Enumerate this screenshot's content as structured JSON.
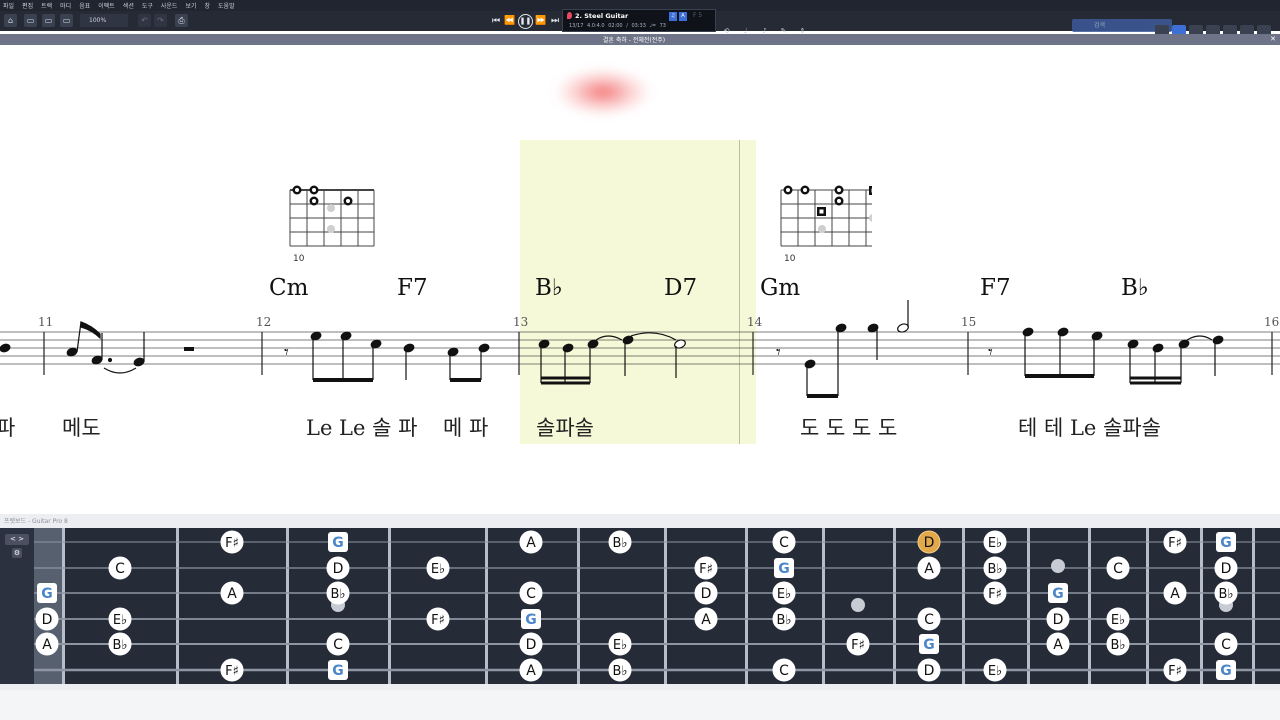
{
  "menu": [
    "파일",
    "편집",
    "트랙",
    "마디",
    "음표",
    "이펙트",
    "섹션",
    "도구",
    "사운드",
    "보기",
    "창",
    "도움말"
  ],
  "toolbar": {
    "zoom": "100%"
  },
  "transport": {
    "track_name": "2. Steel Guitar",
    "bar_position": "13/17",
    "time_signature": "4.0:4.0",
    "time": "02:00 / 03:33",
    "tempo": "♩= 73",
    "mini_label": "F 5"
  },
  "search": {
    "placeholder": "검색"
  },
  "header": {
    "title": "결혼 축하 - 전체전(전주)"
  },
  "score": {
    "chords": [
      {
        "name": "Cm"
      },
      {
        "name": "F7"
      },
      {
        "name": "B♭"
      },
      {
        "name": "D7"
      },
      {
        "name": "Gm"
      },
      {
        "name": "F7"
      },
      {
        "name": "B♭"
      }
    ],
    "diagrams": [
      {
        "fret": "10"
      },
      {
        "fret": "10"
      }
    ],
    "bars": [
      "11",
      "12",
      "13",
      "14",
      "15",
      "16"
    ],
    "lyrics": [
      "파",
      "메도",
      "Le Le 솔 파",
      "메 파",
      "솔파솔",
      "도 도 도 도",
      "테 테 Le 솔파솔"
    ]
  },
  "fretboard": {
    "title": "프렛보드 - Guitar Pro 8",
    "nav": "< >",
    "gear": "⚙",
    "notes": [
      {
        "label": "G",
        "kind": "root"
      },
      {
        "label": "D",
        "kind": "note"
      },
      {
        "label": "A",
        "kind": "note"
      },
      {
        "label": "C",
        "kind": "note"
      },
      {
        "label": "E♭",
        "kind": "note"
      },
      {
        "label": "B♭",
        "kind": "note"
      },
      {
        "label": "F♯",
        "kind": "note"
      },
      {
        "label": "A",
        "kind": "note"
      },
      {
        "label": "F♯",
        "kind": "note"
      },
      {
        "label": "G",
        "kind": "root"
      },
      {
        "label": "D",
        "kind": "note"
      },
      {
        "label": "B♭",
        "kind": "note"
      },
      {
        "label": "C",
        "kind": "note"
      },
      {
        "label": "G",
        "kind": "root"
      },
      {
        "label": "E♭",
        "kind": "note"
      },
      {
        "label": "F♯",
        "kind": "note"
      },
      {
        "label": "A",
        "kind": "note"
      },
      {
        "label": "C",
        "kind": "note"
      },
      {
        "label": "G",
        "kind": "root"
      },
      {
        "label": "D",
        "kind": "note"
      },
      {
        "label": "A",
        "kind": "note"
      },
      {
        "label": "B♭",
        "kind": "note"
      },
      {
        "label": "E♭",
        "kind": "note"
      },
      {
        "label": "B♭",
        "kind": "note"
      },
      {
        "label": "F♯",
        "kind": "note"
      },
      {
        "label": "D",
        "kind": "note"
      },
      {
        "label": "A",
        "kind": "note"
      },
      {
        "label": "C",
        "kind": "note"
      },
      {
        "label": "G",
        "kind": "root"
      },
      {
        "label": "E♭",
        "kind": "note"
      },
      {
        "label": "B♭",
        "kind": "note"
      },
      {
        "label": "C",
        "kind": "note"
      },
      {
        "label": "F♯",
        "kind": "note"
      },
      {
        "label": "D",
        "kind": "active"
      },
      {
        "label": "A",
        "kind": "note"
      },
      {
        "label": "C",
        "kind": "note"
      },
      {
        "label": "G",
        "kind": "root"
      },
      {
        "label": "D",
        "kind": "note"
      },
      {
        "label": "E♭",
        "kind": "note"
      },
      {
        "label": "B♭",
        "kind": "note"
      },
      {
        "label": "F♯",
        "kind": "note"
      },
      {
        "label": "E♭",
        "kind": "note"
      },
      {
        "label": "G",
        "kind": "root"
      },
      {
        "label": "D",
        "kind": "note"
      },
      {
        "label": "A",
        "kind": "note"
      },
      {
        "label": "C",
        "kind": "note"
      },
      {
        "label": "E♭",
        "kind": "note"
      },
      {
        "label": "B♭",
        "kind": "note"
      },
      {
        "label": "A",
        "kind": "note"
      },
      {
        "label": "F♯",
        "kind": "note"
      },
      {
        "label": "F♯",
        "kind": "note"
      },
      {
        "label": "G",
        "kind": "root"
      },
      {
        "label": "D",
        "kind": "note"
      },
      {
        "label": "B♭",
        "kind": "note"
      },
      {
        "label": "C",
        "kind": "note"
      },
      {
        "label": "G",
        "kind": "root"
      }
    ]
  },
  "colors": {
    "root_text": "#4a86c8",
    "active": "#e2a94a",
    "fretboard_bg": "#262b38",
    "highlight": "#f6f9d8"
  }
}
